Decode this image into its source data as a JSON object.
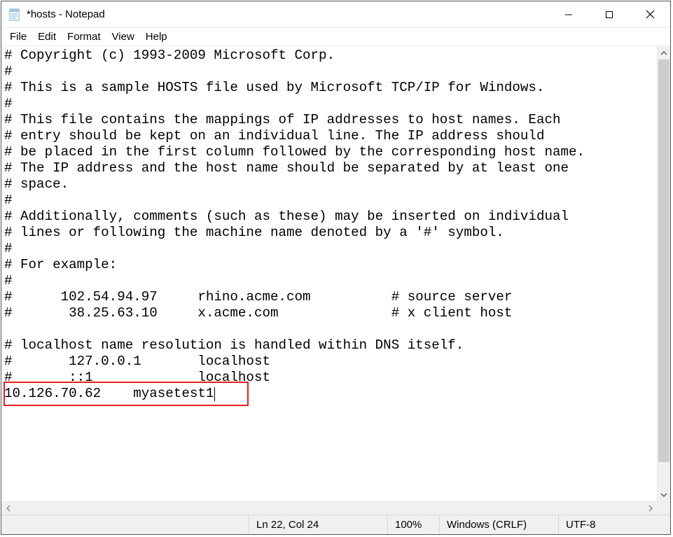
{
  "window": {
    "title": "*hosts - Notepad"
  },
  "menu": {
    "file": "File",
    "edit": "Edit",
    "format": "Format",
    "view": "View",
    "help": "Help"
  },
  "editor": {
    "lines": [
      "# Copyright (c) 1993-2009 Microsoft Corp.",
      "#",
      "# This is a sample HOSTS file used by Microsoft TCP/IP for Windows.",
      "#",
      "# This file contains the mappings of IP addresses to host names. Each",
      "# entry should be kept on an individual line. The IP address should",
      "# be placed in the first column followed by the corresponding host name.",
      "# The IP address and the host name should be separated by at least one",
      "# space.",
      "#",
      "# Additionally, comments (such as these) may be inserted on individual",
      "# lines or following the machine name denoted by a '#' symbol.",
      "#",
      "# For example:",
      "#",
      "#      102.54.94.97     rhino.acme.com          # source server",
      "#       38.25.63.10     x.acme.com              # x client host",
      "",
      "# localhost name resolution is handled within DNS itself.",
      "#       127.0.0.1       localhost",
      "#       ::1             localhost",
      "10.126.70.62    myasetest1"
    ],
    "caret_line_index": 21
  },
  "status": {
    "position": "Ln 22, Col 24",
    "zoom": "100%",
    "line_ending": "Windows (CRLF)",
    "encoding": "UTF-8"
  }
}
